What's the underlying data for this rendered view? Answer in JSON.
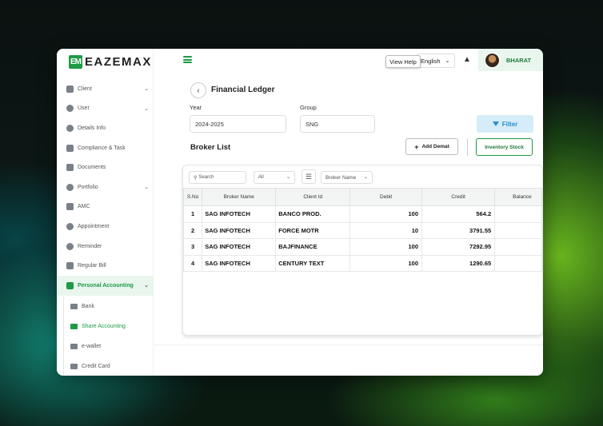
{
  "app": {
    "logo_mark": "EM",
    "logo_text": "EAZEMAX",
    "colors": {
      "accent": "#1e9a45",
      "filter": "#2a8fd0"
    }
  },
  "sidebar": {
    "items": [
      {
        "label": "Client",
        "icon": "building-icon",
        "has_chevron": true
      },
      {
        "label": "User",
        "icon": "user-circle-icon",
        "has_chevron": true
      },
      {
        "label": "Details Info",
        "icon": "info-icon",
        "has_chevron": false
      },
      {
        "label": "Compliance & Task",
        "icon": "list-icon",
        "has_chevron": false
      },
      {
        "label": "Documents",
        "icon": "folder-icon",
        "has_chevron": false
      },
      {
        "label": "Portfolio",
        "icon": "person-icon",
        "has_chevron": true
      },
      {
        "label": "AMC",
        "icon": "card-icon",
        "has_chevron": false
      },
      {
        "label": "Appointment",
        "icon": "person-icon",
        "has_chevron": false
      },
      {
        "label": "Reminder",
        "icon": "gear-icon",
        "has_chevron": false
      },
      {
        "label": "Regular Bill",
        "icon": "receipt-icon",
        "has_chevron": false
      },
      {
        "label": "Personal Accounting",
        "icon": "wallet-icon",
        "has_chevron": true,
        "active": true
      }
    ],
    "sub_items": [
      {
        "label": "Bank",
        "icon": "bank-icon"
      },
      {
        "label": "Share Accounting",
        "icon": "wallet-icon",
        "active": true
      },
      {
        "label": "e-wallet",
        "icon": "wallet-icon"
      },
      {
        "label": "Credit Card",
        "icon": "card-icon"
      }
    ]
  },
  "header": {
    "view_help": "View Help",
    "language": "English",
    "user_name": "BHARAT"
  },
  "page": {
    "title": "Financial Ledger",
    "year_label": "Year",
    "year_value": "2024-2025",
    "group_label": "Group",
    "group_value": "SNG",
    "filter_label": "Filter",
    "broker_list_title": "Broker List",
    "add_demat_label": "Add Demat",
    "inventory_stock_label": "Inventory Stock"
  },
  "table": {
    "search_placeholder": "Search",
    "filter_select": "All",
    "column_select": "Broker Name",
    "columns": [
      "S.No",
      "Broker Name",
      "Client Id",
      "Debit",
      "Credit",
      "Balance"
    ],
    "rows": [
      {
        "sno": "1",
        "broker": "SAG INFOTECH",
        "client": "BANCO PROD.",
        "debit": "100",
        "credit": "564.2"
      },
      {
        "sno": "2",
        "broker": "SAG INFOTECH",
        "client": "FORCE MOTR",
        "debit": "10",
        "credit": "3791.55"
      },
      {
        "sno": "3",
        "broker": "SAG INFOTECH",
        "client": "BAJFINANCE",
        "debit": "100",
        "credit": "7292.95"
      },
      {
        "sno": "4",
        "broker": "SAG INFOTECH",
        "client": "CENTURY TEXT",
        "debit": "100",
        "credit": "1290.65"
      }
    ]
  }
}
